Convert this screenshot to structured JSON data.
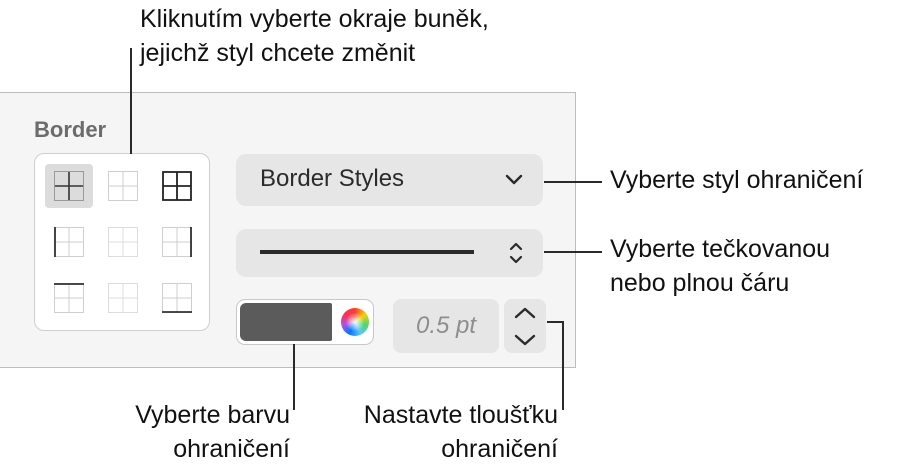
{
  "callouts": {
    "top": [
      "Kliknutím vyberte okraje buněk,",
      "jejichž styl chcete změnit"
    ],
    "border_style": [
      "Vyberte styl ohraničení"
    ],
    "line_type": [
      "Vyberte tečkovanou",
      "nebo plnou čáru"
    ],
    "color": [
      "Vyberte barvu",
      "ohraničení"
    ],
    "thickness": [
      "Nastavte tloušťku",
      "ohraničení"
    ]
  },
  "panel": {
    "title": "Border",
    "border_styles_label": "Border Styles",
    "line_style": "solid",
    "border_color": "#5b5b5b",
    "width_value": "0.5 pt"
  },
  "border_buttons": [
    {
      "name": "inside-borders",
      "selected": true
    },
    {
      "name": "inside-horizontal",
      "selected": false
    },
    {
      "name": "all-borders",
      "selected": false
    },
    {
      "name": "left-border",
      "selected": false
    },
    {
      "name": "inside-vertical",
      "selected": false
    },
    {
      "name": "right-border",
      "selected": false
    },
    {
      "name": "top-border",
      "selected": false
    },
    {
      "name": "no-borders",
      "selected": false
    },
    {
      "name": "bottom-border",
      "selected": false
    }
  ],
  "colors": {
    "accent_dark": "#2b2b2b",
    "panel_bg": "#f5f5f5",
    "control_bg": "#e6e6e6"
  }
}
